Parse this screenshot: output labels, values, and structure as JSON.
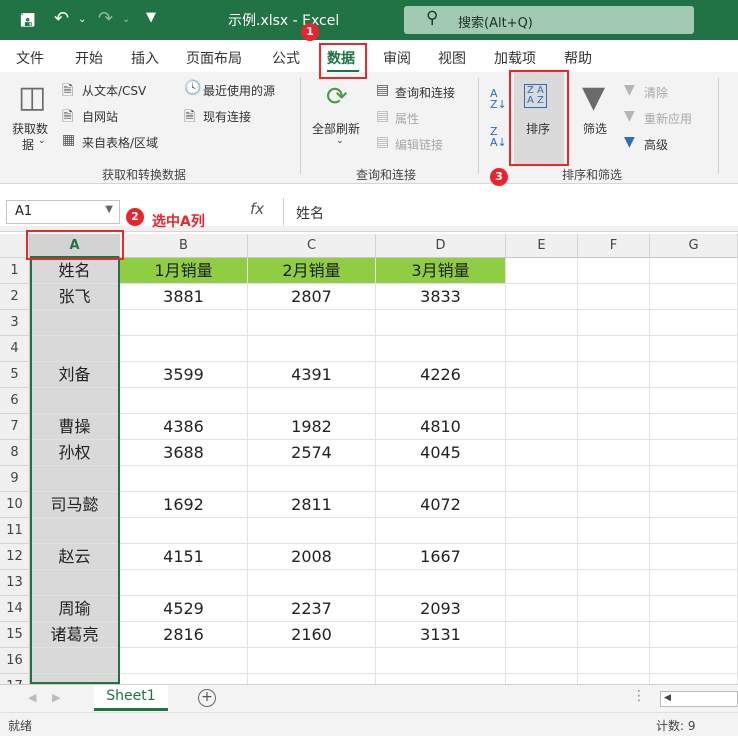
{
  "titlebar": {
    "save_icon": "save-icon",
    "undo_icon": "undo-icon",
    "redo_icon": "redo-icon",
    "title": "示例.xlsx  -  Excel",
    "search_placeholder": "搜索(Alt+Q)"
  },
  "menu": {
    "tabs": [
      "文件",
      "开始",
      "插入",
      "页面布局",
      "公式",
      "数据",
      "审阅",
      "视图",
      "加载项",
      "帮助"
    ],
    "active": "数据"
  },
  "ribbon": {
    "get_data": {
      "big_label_1": "获取数",
      "big_label_2": "据",
      "from_text": "从文本/CSV",
      "from_web": "自网站",
      "from_table": "来自表格/区域",
      "recent_sources": "最近使用的源",
      "existing_connections": "现有连接",
      "group_label": "获取和转换数据"
    },
    "queries": {
      "refresh_all": "全部刷新",
      "queries_connections": "查询和连接",
      "properties": "属性",
      "edit_links": "编辑链接",
      "group_label": "查询和连接"
    },
    "sort_filter": {
      "sort": "排序",
      "filter": "筛选",
      "clear": "清除",
      "reapply": "重新应用",
      "advanced": "高级",
      "group_label": "排序和筛选"
    }
  },
  "formula_bar": {
    "name_box": "A1",
    "fx": "fx",
    "formula": "姓名"
  },
  "annotations": {
    "step1": "1",
    "step2": "2",
    "step2_text": "选中A列",
    "step3": "3"
  },
  "grid": {
    "columns": [
      "A",
      "B",
      "C",
      "D",
      "E",
      "F",
      "G"
    ],
    "rows": [
      {
        "num": "1",
        "cells": [
          "姓名",
          "1月销量",
          "2月销量",
          "3月销量"
        ]
      },
      {
        "num": "2",
        "cells": [
          "张飞",
          "3881",
          "2807",
          "3833"
        ]
      },
      {
        "num": "3",
        "cells": [
          "",
          "",
          "",
          ""
        ]
      },
      {
        "num": "4",
        "cells": [
          "",
          "",
          "",
          ""
        ]
      },
      {
        "num": "5",
        "cells": [
          "刘备",
          "3599",
          "4391",
          "4226"
        ]
      },
      {
        "num": "6",
        "cells": [
          "",
          "",
          "",
          ""
        ]
      },
      {
        "num": "7",
        "cells": [
          "曹操",
          "4386",
          "1982",
          "4810"
        ]
      },
      {
        "num": "8",
        "cells": [
          "孙权",
          "3688",
          "2574",
          "4045"
        ]
      },
      {
        "num": "9",
        "cells": [
          "",
          "",
          "",
          ""
        ]
      },
      {
        "num": "10",
        "cells": [
          "司马懿",
          "1692",
          "2811",
          "4072"
        ]
      },
      {
        "num": "11",
        "cells": [
          "",
          "",
          "",
          ""
        ]
      },
      {
        "num": "12",
        "cells": [
          "赵云",
          "4151",
          "2008",
          "1667"
        ]
      },
      {
        "num": "13",
        "cells": [
          "",
          "",
          "",
          ""
        ]
      },
      {
        "num": "14",
        "cells": [
          "周瑜",
          "4529",
          "2237",
          "2093"
        ]
      },
      {
        "num": "15",
        "cells": [
          "诸葛亮",
          "2816",
          "2160",
          "3131"
        ]
      },
      {
        "num": "16",
        "cells": [
          "",
          "",
          "",
          ""
        ]
      },
      {
        "num": "17",
        "cells": [
          "",
          "",
          "",
          ""
        ]
      }
    ]
  },
  "sheet_tabs": {
    "active": "Sheet1",
    "add_icon": "plus-circle-icon"
  },
  "status": {
    "mode": "就绪",
    "count": "计数: 9"
  },
  "colors": {
    "excel_green": "#217346",
    "header_fill": "#8fce43",
    "annotation_red": "#e8242c"
  }
}
